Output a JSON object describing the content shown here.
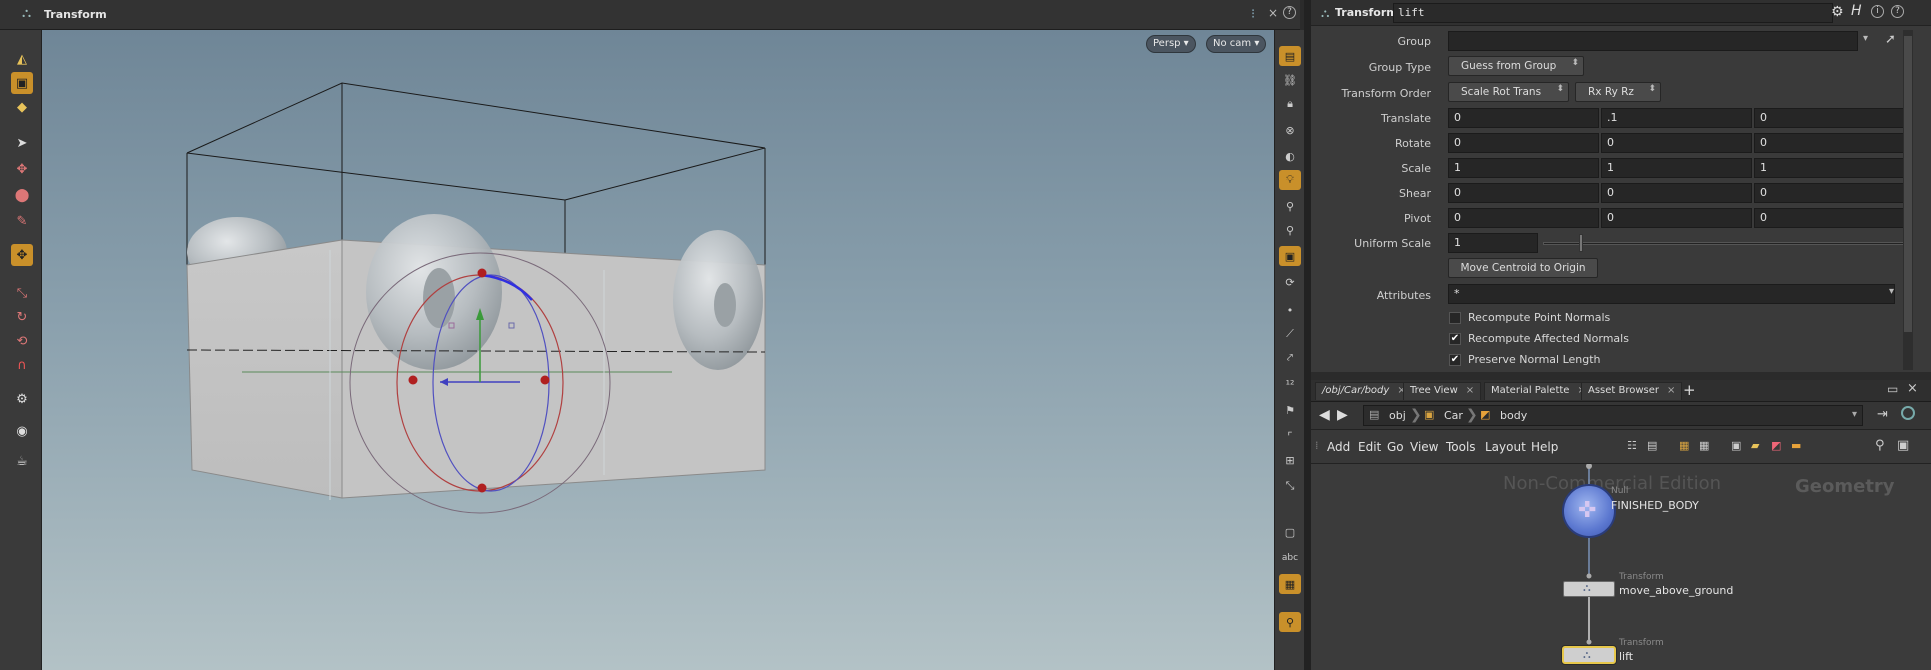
{
  "viewport": {
    "title": "Transform",
    "persp_label": "Persp",
    "cam_label": "No cam"
  },
  "param": {
    "node_type": "Transform",
    "node_name": "lift",
    "group_label": "Group",
    "group_value": "",
    "group_type_label": "Group Type",
    "group_type_value": "Guess from Group",
    "xform_order_label": "Transform Order",
    "xform_order_value": "Scale Rot Trans",
    "rot_order_value": "Rx Ry Rz",
    "translate_label": "Translate",
    "translate": [
      "0",
      ".1",
      "0"
    ],
    "rotate_label": "Rotate",
    "rotate": [
      "0",
      "0",
      "0"
    ],
    "scale_label": "Scale",
    "scale": [
      "1",
      "1",
      "1"
    ],
    "shear_label": "Shear",
    "shear": [
      "0",
      "0",
      "0"
    ],
    "pivot_label": "Pivot",
    "pivot": [
      "0",
      "0",
      "0"
    ],
    "uniform_scale_label": "Uniform Scale",
    "uniform_scale": "1",
    "move_centroid_label": "Move Centroid to Origin",
    "attributes_label": "Attributes",
    "attributes_value": "*",
    "recompute_point_normals": {
      "label": "Recompute Point Normals",
      "checked": false,
      "mark": ""
    },
    "recompute_affected_normals": {
      "label": "Recompute Affected Normals",
      "checked": true,
      "mark": "✔"
    },
    "preserve_normal_length": {
      "label": "Preserve Normal Length",
      "checked": true,
      "mark": "✔"
    }
  },
  "network": {
    "tabs": [
      "/obj/Car/body",
      "Tree View",
      "Material Palette",
      "Asset Browser"
    ],
    "tab_add": "+",
    "path": [
      "obj",
      "Car",
      "body"
    ],
    "menu": [
      "Add",
      "Edit",
      "Go",
      "View",
      "Tools",
      "Layout",
      "Help"
    ],
    "watermark": "Non-Commercial Edition",
    "context_label": "Geometry",
    "nodes": [
      {
        "type": "Null",
        "name": "FINISHED_BODY"
      },
      {
        "type": "Transform",
        "name": "move_above_ground"
      },
      {
        "type": "Transform",
        "name": "lift"
      }
    ]
  },
  "colors": {
    "accent": "#c9902a",
    "selected_node": "#e6c74a"
  }
}
